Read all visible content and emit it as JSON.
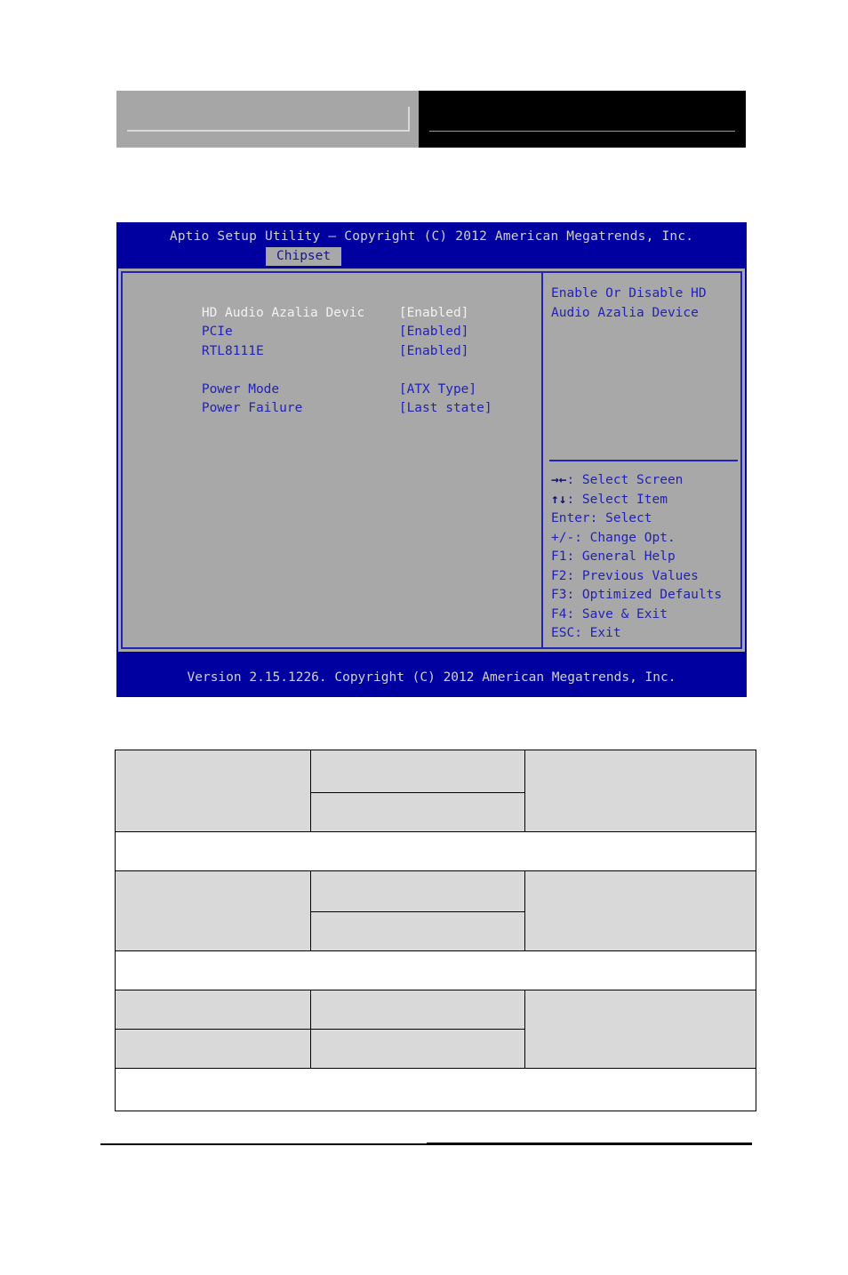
{
  "header": {
    "left_box_label": "",
    "right_box_label": ""
  },
  "bios": {
    "title": "Aptio Setup Utility – Copyright (C) 2012 American Megatrends, Inc.",
    "active_tab": "Chipset",
    "footer": "Version 2.15.1226. Copyright (C) 2012 American Megatrends, Inc.",
    "colors": {
      "screen_blue": "#0000a0",
      "panel_gray": "#a8a8a8",
      "text_blue": "#2222b4",
      "selected_text": "#f2f2f2"
    },
    "options": [
      {
        "label": "HD Audio Azalia Devic",
        "value": "[Enabled]",
        "selected": true
      },
      {
        "label": "PCIe",
        "value": "[Enabled]",
        "selected": false
      },
      {
        "label": "RTL8111E",
        "value": "[Enabled]",
        "selected": false
      },
      {
        "label": "",
        "value": "",
        "selected": false
      },
      {
        "label": "Power Mode",
        "value": "[ATX Type]",
        "selected": false
      },
      {
        "label": "Power Failure",
        "value": "[Last state]",
        "selected": false
      }
    ],
    "help_lines": [
      "Enable Or Disable HD",
      "Audio Azalia Device"
    ],
    "keys": [
      {
        "glyph": "→←",
        "text": ": Select Screen"
      },
      {
        "glyph": "↑↓",
        "text": ": Select Item"
      },
      {
        "glyph": "",
        "text": "Enter: Select"
      },
      {
        "glyph": "",
        "text": "+/-: Change Opt."
      },
      {
        "glyph": "",
        "text": "F1: General Help"
      },
      {
        "glyph": "",
        "text": "F2: Previous Values"
      },
      {
        "glyph": "",
        "text": "F3: Optimized Defaults"
      },
      {
        "glyph": "",
        "text": "F4: Save & Exit"
      },
      {
        "glyph": "",
        "text": "ESC: Exit"
      }
    ]
  },
  "spec_table": {
    "blocks": [
      {
        "feature": "",
        "options": [
          "",
          ""
        ],
        "description": "",
        "note": ""
      },
      {
        "feature": "",
        "options": [
          "",
          ""
        ],
        "description": "",
        "note": ""
      },
      {
        "feature": "",
        "options": [
          "",
          ""
        ],
        "description": "",
        "note": ""
      }
    ]
  }
}
